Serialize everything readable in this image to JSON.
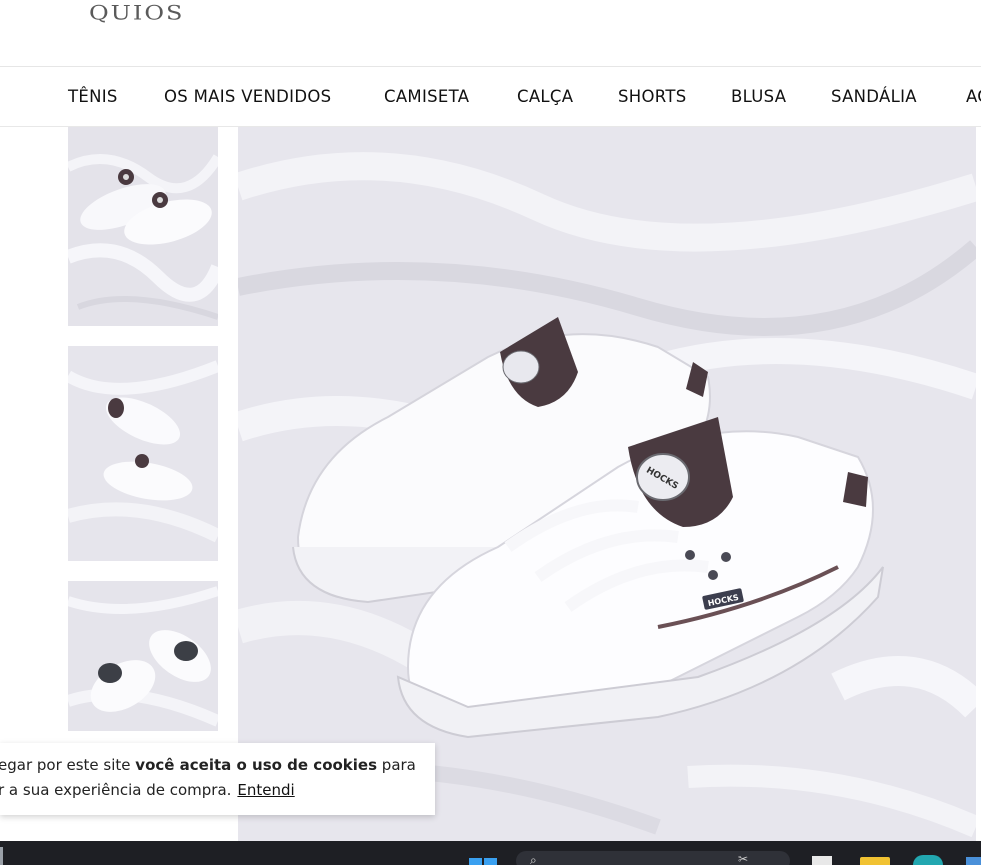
{
  "header": {
    "logo_text": "QUIOS"
  },
  "nav": {
    "items": [
      {
        "label": "TÊNIS"
      },
      {
        "label": "OS MAIS VENDIDOS"
      },
      {
        "label": "CAMISETA"
      },
      {
        "label": "CALÇA"
      },
      {
        "label": "SHORTS"
      },
      {
        "label": "BLUSA"
      },
      {
        "label": "SANDÁLIA"
      },
      {
        "label": "AC"
      }
    ]
  },
  "product": {
    "brand_tag": "HOCKS",
    "thumbnails": [
      {
        "name": "thumb-1"
      },
      {
        "name": "thumb-2"
      },
      {
        "name": "thumb-3"
      }
    ]
  },
  "cookie": {
    "line1_prefix": "egar por este site ",
    "line1_bold": "você aceita o uso de cookies",
    "line1_suffix": " para",
    "line2_text": "r a sua experiência de compra.",
    "accept_label": "Entendi"
  },
  "taskbar": {
    "icons": [
      "windows-start-icon",
      "search-box",
      "file-explorer-icon",
      "edge-icon"
    ]
  },
  "colors": {
    "shoe_accent": "#4a3a40",
    "fabric": "#e9e8ef",
    "taskbar": "#1e1f24",
    "windows_blue": "#3aa0f0"
  }
}
